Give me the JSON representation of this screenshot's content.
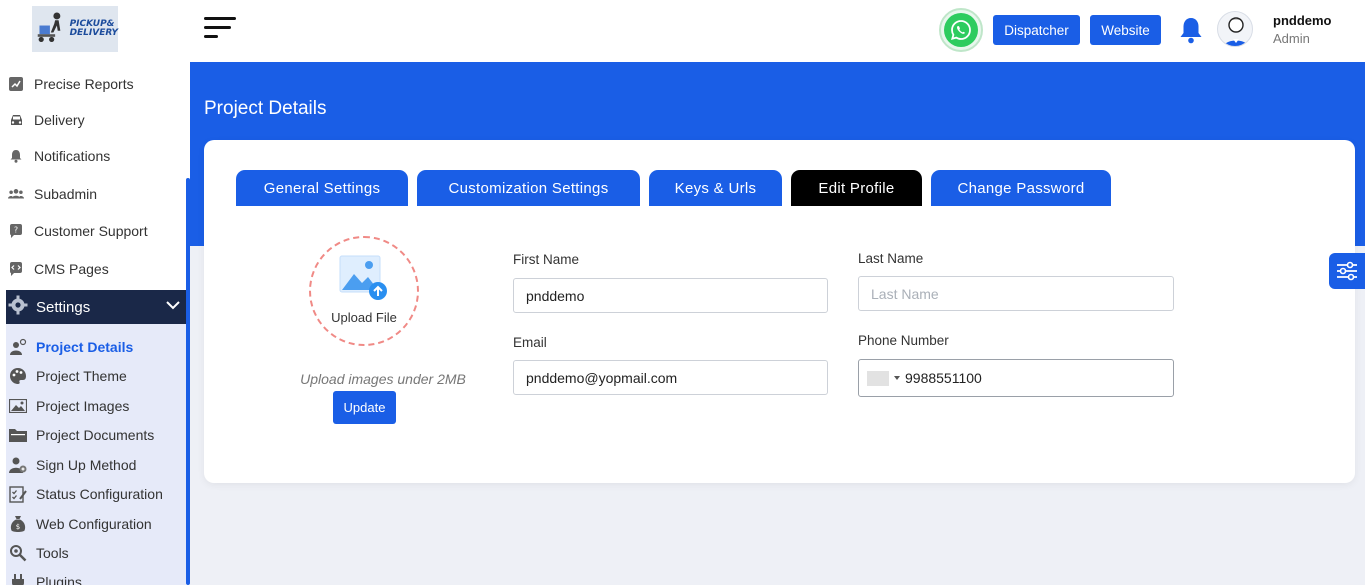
{
  "logo": {
    "text_line1": "PICKUP&",
    "text_line2": "DELIVERY"
  },
  "sidebar": {
    "items": [
      {
        "label": "Precise Reports",
        "icon": "reports-icon"
      },
      {
        "label": "Delivery",
        "icon": "car-icon"
      },
      {
        "label": "Notifications",
        "icon": "bell-icon"
      },
      {
        "label": "Subadmin",
        "icon": "users-icon"
      },
      {
        "label": "Customer Support",
        "icon": "support-icon"
      },
      {
        "label": "CMS Pages",
        "icon": "code-icon"
      }
    ],
    "settings": {
      "label": "Settings",
      "icon": "gear-icon"
    },
    "submenu": [
      {
        "label": "Project Details",
        "icon": "project-details-icon",
        "active": true
      },
      {
        "label": "Project Theme",
        "icon": "palette-icon"
      },
      {
        "label": "Project Images",
        "icon": "image-icon"
      },
      {
        "label": "Project Documents",
        "icon": "folder-icon"
      },
      {
        "label": "Sign Up Method",
        "icon": "user-add-icon"
      },
      {
        "label": "Status Configuration",
        "icon": "checklist-icon"
      },
      {
        "label": "Web Configuration",
        "icon": "money-bag-icon"
      },
      {
        "label": "Tools",
        "icon": "tools-icon"
      },
      {
        "label": "Plugins",
        "icon": "plug-icon"
      }
    ]
  },
  "header": {
    "dispatcher_label": "Dispatcher",
    "website_label": "Website",
    "user_name": "pnddemo",
    "user_role": "Admin"
  },
  "page": {
    "title": "Project Details",
    "tabs": [
      {
        "label": "General Settings"
      },
      {
        "label": "Customization Settings"
      },
      {
        "label": "Keys & Urls"
      },
      {
        "label": "Edit Profile",
        "active": true
      },
      {
        "label": "Change Password"
      }
    ]
  },
  "profile": {
    "upload_label": "Upload File",
    "upload_hint": "Upload images under 2MB",
    "update_label": "Update",
    "first_name_label": "First Name",
    "first_name_value": "pnddemo",
    "last_name_label": "Last Name",
    "last_name_placeholder": "Last Name",
    "email_label": "Email",
    "email_value": "pnddemo@yopmail.com",
    "phone_label": "Phone Number",
    "phone_value": "9988551100"
  },
  "colors": {
    "primary": "#1a5ee6",
    "sidebar_dark": "#1a2848",
    "active_tab": "#000000",
    "whatsapp": "#2ecc5f"
  }
}
